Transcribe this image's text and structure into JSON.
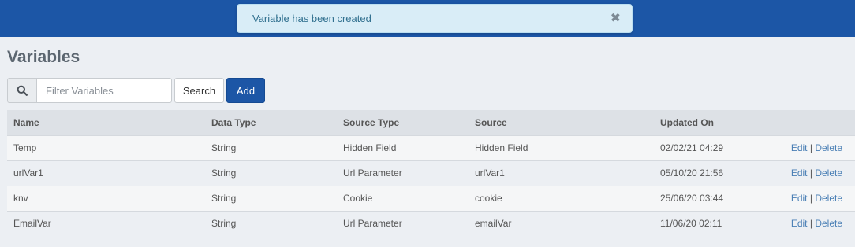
{
  "toast": {
    "message": "Variable has been created",
    "close_glyph": "✖"
  },
  "page": {
    "title": "Variables"
  },
  "search": {
    "placeholder": "Filter Variables",
    "value": "",
    "search_label": "Search",
    "add_label": "Add",
    "icon": "search-icon"
  },
  "table": {
    "headers": [
      "Name",
      "Data Type",
      "Source Type",
      "Source",
      "Updated On",
      ""
    ],
    "rows": [
      {
        "name": "Temp",
        "data_type": "String",
        "source_type": "Hidden Field",
        "source": "Hidden Field",
        "updated_on": "02/02/21 04:29",
        "edit": "Edit",
        "sep": "|",
        "delete": "Delete"
      },
      {
        "name": "urlVar1",
        "data_type": "String",
        "source_type": "Url Parameter",
        "source": "urlVar1",
        "updated_on": "05/10/20 21:56",
        "edit": "Edit",
        "sep": "|",
        "delete": "Delete"
      },
      {
        "name": "knv",
        "data_type": "String",
        "source_type": "Cookie",
        "source": "cookie",
        "updated_on": "25/06/20 03:44",
        "edit": "Edit",
        "sep": "|",
        "delete": "Delete"
      },
      {
        "name": "EmailVar",
        "data_type": "String",
        "source_type": "Url Parameter",
        "source": "emailVar",
        "updated_on": "11/06/20 02:11",
        "edit": "Edit",
        "sep": "|",
        "delete": "Delete"
      }
    ]
  },
  "colors": {
    "topbar": "#1c56a6",
    "toast_bg": "#d9edf7",
    "toast_text": "#31708f",
    "link": "#4a7fb5",
    "primary_button": "#1c56a6"
  }
}
